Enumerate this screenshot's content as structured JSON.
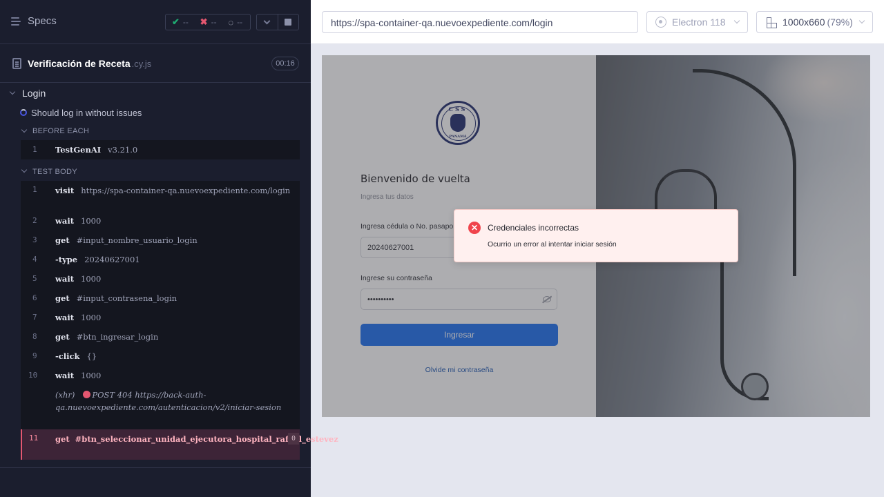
{
  "reporter": {
    "specs_label": "Specs",
    "stats": {
      "passed": "--",
      "failed": "--",
      "pending": "--"
    },
    "spec": {
      "name": "Verificación de Receta",
      "ext": ".cy.js",
      "duration": "00:16"
    },
    "suite": "Login",
    "test": "Should log in without issues",
    "before_each": {
      "title": "BEFORE EACH",
      "commands": [
        {
          "n": "1",
          "name": "TestGenAI",
          "message": "v3.21.0"
        }
      ]
    },
    "test_body": {
      "title": "TEST BODY",
      "commands": [
        {
          "n": "1",
          "name": "visit",
          "message": "https://spa-container-qa.nuevoexpediente.com/login"
        },
        {
          "n": "2",
          "name": "wait",
          "message": "1000"
        },
        {
          "n": "3",
          "name": "get",
          "message": "#input_nombre_usuario_login"
        },
        {
          "n": "4",
          "name": "-type",
          "message": "20240627001"
        },
        {
          "n": "5",
          "name": "wait",
          "message": "1000"
        },
        {
          "n": "6",
          "name": "get",
          "message": "#input_contrasena_login"
        },
        {
          "n": "7",
          "name": "wait",
          "message": "1000"
        },
        {
          "n": "8",
          "name": "get",
          "message": "#btn_ingresar_login"
        },
        {
          "n": "9",
          "name": "-click",
          "message": "{}"
        },
        {
          "n": "10",
          "name": "wait",
          "message": "1000"
        }
      ],
      "xhr": {
        "label": "(xhr)",
        "text": "POST 404 https://back-auth-qa.nuevoexpediente.com/autenticacion/v2/iniciar-sesion"
      },
      "failed_command": {
        "n": "11",
        "name": "get",
        "message": "#btn_seleccionar_unidad_ejecutora_hospital_rafael_estevez",
        "count": "0"
      }
    }
  },
  "aut_header": {
    "url": "https://spa-container-qa.nuevoexpediente.com/login",
    "browser": "Electron 118",
    "viewport": "1000x660",
    "zoom": "(79%)"
  },
  "app": {
    "logo_top": "CSS",
    "logo_bottom": "PANAMÁ",
    "welcome": "Bienvenido de vuelta",
    "subtitle": "Ingresa tus datos",
    "user_label": "Ingresa cédula o No. pasapo",
    "user_value": "20240627001",
    "password_label": "Ingrese su contraseña",
    "password_value": "••••••••••",
    "login_button": "Ingresar",
    "forgot_link": "Olvide mi contraseña",
    "toast": {
      "title": "Credenciales incorrectas",
      "message": "Ocurrio un error al intentar iniciar sesión"
    }
  },
  "colors": {
    "accent": "#1a6ef0",
    "error": "#e45770",
    "reporter_bg": "#1b1e2e"
  }
}
